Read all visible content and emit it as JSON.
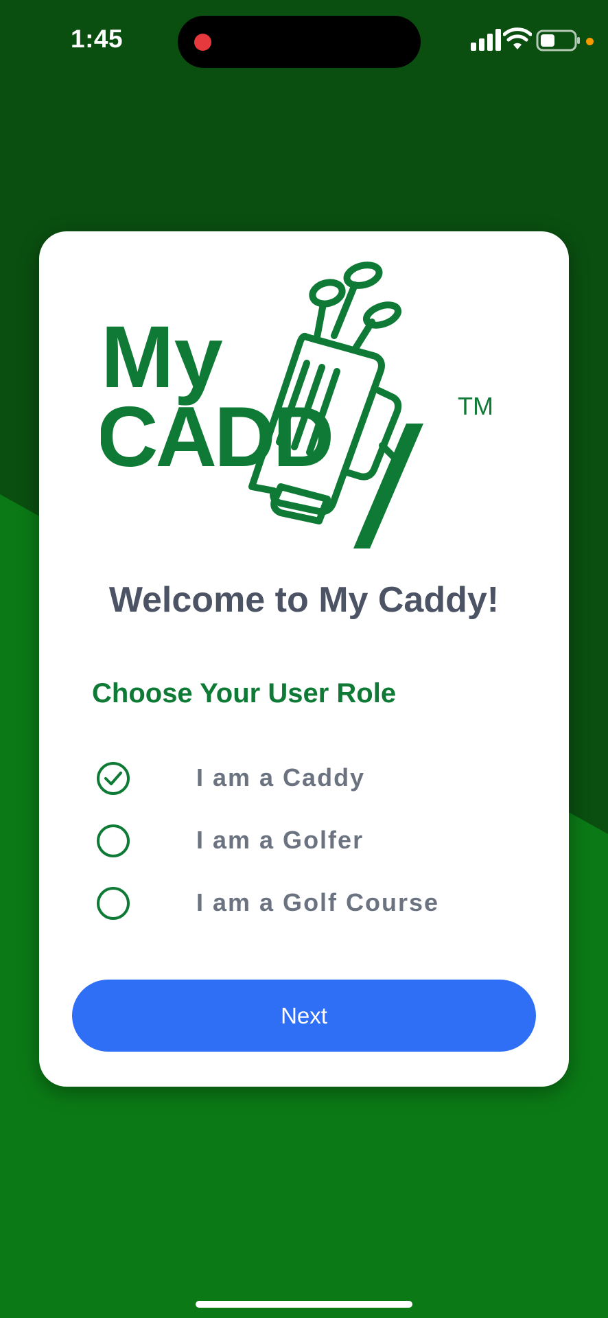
{
  "status_bar": {
    "time": "1:45"
  },
  "logo": {
    "line1": "My",
    "line2": "CADD",
    "trademark": "TM"
  },
  "welcome": {
    "title": "Welcome to My Caddy!"
  },
  "roles": {
    "heading": "Choose Your User Role",
    "options": [
      {
        "label": "I am a Caddy",
        "selected": true
      },
      {
        "label": "I am a Golfer",
        "selected": false
      },
      {
        "label": "I am a Golf Course",
        "selected": false
      }
    ]
  },
  "actions": {
    "next_label": "Next"
  },
  "colors": {
    "background_green": "#0b7a16",
    "background_dark_green": "#0a4f10",
    "brand_green": "#0e7a35",
    "button_blue": "#2f6ff5",
    "title_gray": "#4b5364",
    "label_gray": "#6b7280"
  },
  "icons": {
    "signal": "cellular-signal-icon",
    "wifi": "wifi-icon",
    "battery": "battery-icon",
    "recording": "recording-dot-icon",
    "selected_radio": "check-circle-icon",
    "unselected_radio": "empty-circle-icon"
  }
}
